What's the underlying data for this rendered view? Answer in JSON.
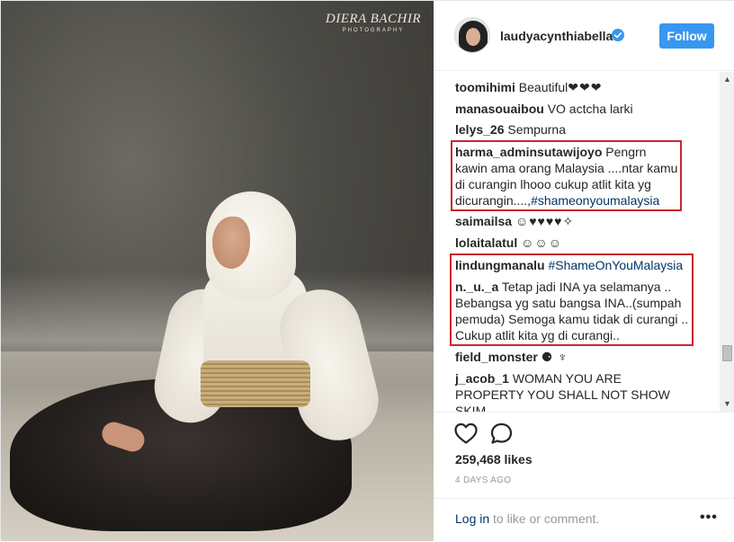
{
  "photo": {
    "watermark_name": "DIERA BACHIR",
    "watermark_sub": "PHOTOGRAPHY"
  },
  "header": {
    "username": "laudyacynthiabella",
    "follow_label": "Follow"
  },
  "comments": [
    {
      "user": "toomihimi",
      "text": "Beautiful",
      "emoji": "❤❤❤"
    },
    {
      "user": "manasouaibou",
      "text": "VO actcha larki"
    },
    {
      "user": "lelys_26",
      "text": "Sempurna"
    },
    {
      "user": "harma_adminsutawijoyo",
      "text": "Pengrn kawin ama orang Malaysia ....ntar kamu di curangin lhooo cukup atlit kita yg dicurangin....,",
      "tag": "#shameonyoumalaysia"
    },
    {
      "user": "saimailsa",
      "text": "",
      "emoji": "☺♥♥♥♥✧"
    },
    {
      "user": "lolaitalatul",
      "text": "",
      "emoji": "☺☺☺"
    },
    {
      "user": "lindungmanalu",
      "text": "",
      "tag": "#ShameOnYouMalaysia"
    },
    {
      "user": "n._u._a",
      "text": "Tetap jadi INA ya selamanya .. Bebangsa yg satu bangsa INA..(sumpah pemuda) Semoga kamu tidak di curangi .. Cukup atlit kita yg di curangi.."
    },
    {
      "user": "field_monster",
      "text": "",
      "emoji": "⚈ ♆"
    },
    {
      "user": "j_acob_1",
      "text": "WOMAN YOU ARE PROPERTY YOU SHALL NOT SHOW SKIM"
    }
  ],
  "actions": {
    "likes": "259,468 likes",
    "timestamp": "4 DAYS AGO",
    "login_link": "Log in",
    "login_rest": " to like or comment.",
    "more": "•••"
  },
  "scrollbar": {
    "up_arrow": "▲",
    "down_arrow": "▼"
  },
  "colors": {
    "follow_button": "#3897f0",
    "highlight_border": "#c8282d",
    "hashtag": "#003569",
    "verified_badge": "#3897f0"
  }
}
